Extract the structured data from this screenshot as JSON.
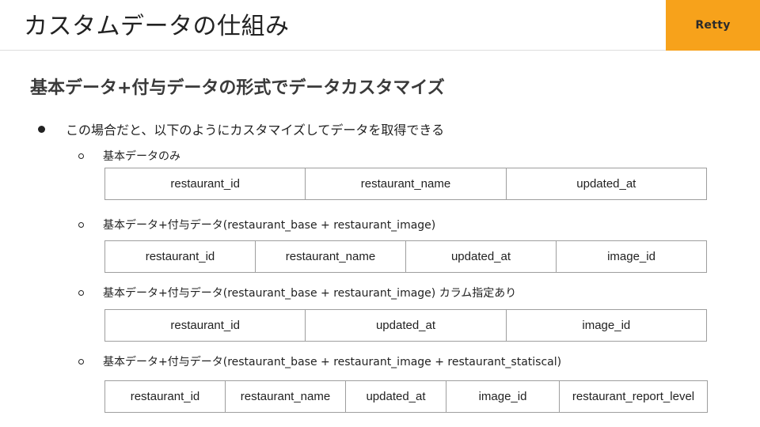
{
  "header": {
    "title": "カスタムデータの仕組み",
    "logo_text": "Retty",
    "brand_color": "#f7a21b"
  },
  "subtitle": "基本データ+付与データの形式でデータカスタマイズ",
  "bullet": "この場合だと、以下のようにカスタマイズしてデータを取得できる",
  "sections": [
    {
      "label": "基本データのみ",
      "columns": [
        "restaurant_id",
        "restaurant_name",
        "updated_at"
      ]
    },
    {
      "label": "基本データ+付与データ(restaurant_base + restaurant_image)",
      "columns": [
        "restaurant_id",
        "restaurant_name",
        "updated_at",
        "image_id"
      ]
    },
    {
      "label": "基本データ+付与データ(restaurant_base + restaurant_image) カラム指定あり",
      "columns": [
        "restaurant_id",
        "updated_at",
        "image_id"
      ]
    },
    {
      "label": "基本データ+付与データ(restaurant_base + restaurant_image + restaurant_statiscal)",
      "columns": [
        "restaurant_id",
        "restaurant_name",
        "updated_at",
        "image_id",
        "restaurant_report_level"
      ]
    }
  ]
}
